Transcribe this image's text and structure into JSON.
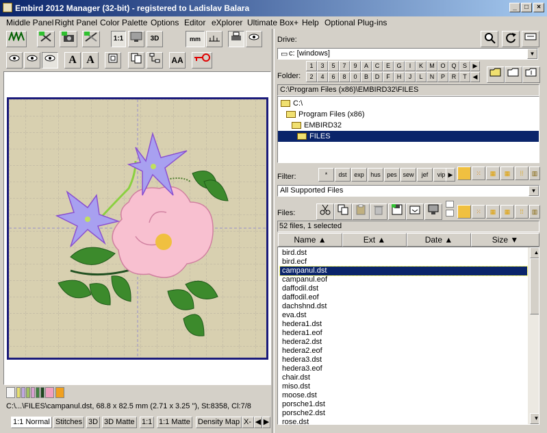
{
  "window": {
    "title": "Embird 2012 Manager (32-bit) - registered to Ladislav Balara",
    "min": "_",
    "max": "□",
    "close": "×"
  },
  "menu": [
    "Middle Panel",
    "Right Panel",
    "Color Palette",
    "Options",
    "Editor",
    "eXplorer",
    "Ultimate Box+",
    "Help",
    "Optional Plug-ins"
  ],
  "toolbar": {
    "one_to_one": "1:1",
    "three_d": "3D",
    "mm": "mm",
    "text_a": "A",
    "text_aa": "AA"
  },
  "drive": {
    "label": "Drive:",
    "value": "c: [windows]"
  },
  "folder": {
    "label": "Folder:",
    "quick_row1": [
      "1",
      "3",
      "5",
      "7",
      "9",
      "A",
      "C",
      "E",
      "G",
      "I",
      "K",
      "M",
      "O",
      "Q",
      "S"
    ],
    "quick_row2": [
      "2",
      "4",
      "6",
      "8",
      "0",
      "B",
      "D",
      "F",
      "H",
      "J",
      "L",
      "N",
      "P",
      "R",
      "T"
    ],
    "path": "C:\\Program Files (x86)\\EMBIRD32\\FILES"
  },
  "tree": [
    {
      "label": "C:\\",
      "indent": 0
    },
    {
      "label": "Program Files (x86)",
      "indent": 1
    },
    {
      "label": "EMBIRD32",
      "indent": 2
    },
    {
      "label": "FILES",
      "indent": 3,
      "selected": true
    }
  ],
  "filter": {
    "label": "Filter:",
    "buttons": [
      "*",
      "dst",
      "exp",
      "hus",
      "pes",
      "sew",
      "jef",
      "vip"
    ],
    "value": "All Supported Files"
  },
  "files": {
    "label": "Files:",
    "status": "52 files, 1 selected",
    "columns": [
      "Name",
      "Ext",
      "Date",
      "Size"
    ],
    "items": [
      "bird.dst",
      "bird.ecf",
      "campanul.dst",
      "campanul.eof",
      "daffodil.dst",
      "daffodil.eof",
      "dachshnd.dst",
      "eva.dst",
      "hedera1.dst",
      "hedera1.eof",
      "hedera2.dst",
      "hedera2.eof",
      "hedera3.dst",
      "hedera3.eof",
      "chair.dst",
      "miso.dst",
      "moose.dst",
      "porsche1.dst",
      "porsche2.dst",
      "rose.dst"
    ],
    "selected_index": 2
  },
  "status_bar": "C:\\...\\FILES\\campanul.dst, 68.8 x 82.5 mm (2.71 x 3.25 \"), St:8358, Cl:7/8",
  "view_tabs": [
    "1:1 Normal",
    "Stitches",
    "3D",
    "3D Matte",
    "1:1",
    "1:1 Matte",
    "Density Map",
    "X-"
  ],
  "palette": [
    "#f4f4f4",
    "#e8e070",
    "#c0a8e0",
    "#a0c060",
    "#d8a0d0",
    "#408040",
    "#204820",
    "#f0a0c0",
    "#f0a020"
  ],
  "colors": {
    "canvas_bg": "#d8d0b0",
    "canvas_border": "#1a1a7a",
    "selection": "#0a246a"
  }
}
